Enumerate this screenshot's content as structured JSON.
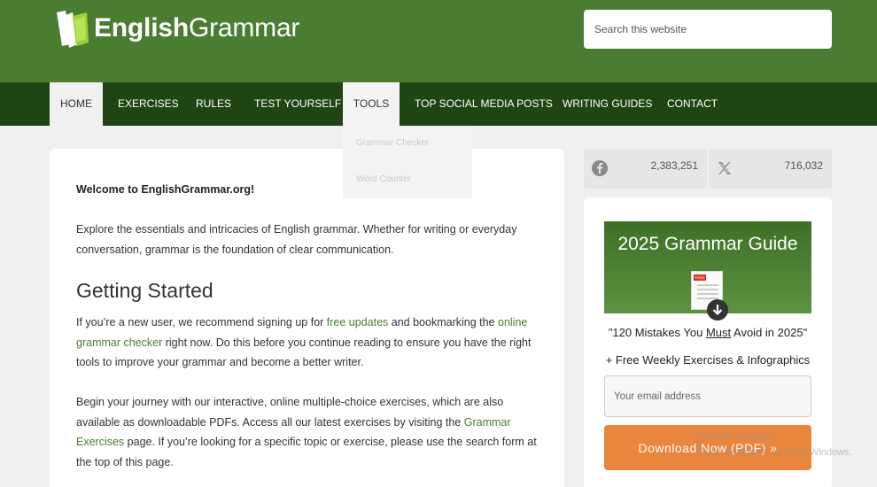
{
  "header": {
    "logo_bold": "English",
    "logo_light": "Grammar",
    "search_placeholder": "Search this website"
  },
  "nav": {
    "items": [
      {
        "label": "HOME"
      },
      {
        "label": "EXERCISES"
      },
      {
        "label": "RULES"
      },
      {
        "label": "TEST YOURSELF"
      },
      {
        "label": "TOOLS"
      },
      {
        "label": "TOP SOCIAL MEDIA POSTS"
      },
      {
        "label": "WRITING GUIDES"
      },
      {
        "label": "CONTACT"
      }
    ],
    "tools_dropdown": [
      "Grammar Checker",
      "Word Counter"
    ]
  },
  "main": {
    "welcome": "Welcome to EnglishGrammar.org!",
    "intro": "Explore the essentials and intricacies of English grammar. Whether for writing or everyday conversation, grammar is the foundation of clear communication.",
    "heading": "Getting Started",
    "p1_a": "If you’re a new user, we recommend signing up for ",
    "p1_link1": "free updates",
    "p1_b": " and bookmarking the ",
    "p1_link2": "online grammar checker",
    "p1_c": " right now. Do this before you continue reading to ensure you have the right tools to improve your grammar and become a better writer.",
    "p2_a": "Begin your journey with our interactive, online multiple-choice exercises, which are also available as downloadable PDFs. Access all our latest exercises by visiting the ",
    "p2_link": "Grammar Exercises",
    "p2_b": " page. If you’re looking for a specific topic or exercise, please use the search form at the top of this page."
  },
  "social": {
    "facebook_count": "2,383,251",
    "x_count": "716,032",
    "facebook_icon": "facebook-icon",
    "x_icon": "x-icon"
  },
  "sidebar": {
    "guide_title": "2025 Grammar Guide",
    "doc_tag": "FREE",
    "mistakes_a": "\"120 Mistakes You ",
    "mistakes_u": "Must",
    "mistakes_b": " Avoid in 2025\"",
    "weekly": "+ Free Weekly Exercises & Infographics",
    "email_placeholder": "Your email address",
    "download_label": "Download Now (PDF) »"
  },
  "watermark": {
    "line1": "Activate Windows",
    "line2": "Go to Settings to activate Windows."
  },
  "colors": {
    "header_green": "#4a7d32",
    "nav_dark_green": "#1f4512",
    "link_green": "#4a7d32",
    "button_orange": "#e9853d"
  }
}
